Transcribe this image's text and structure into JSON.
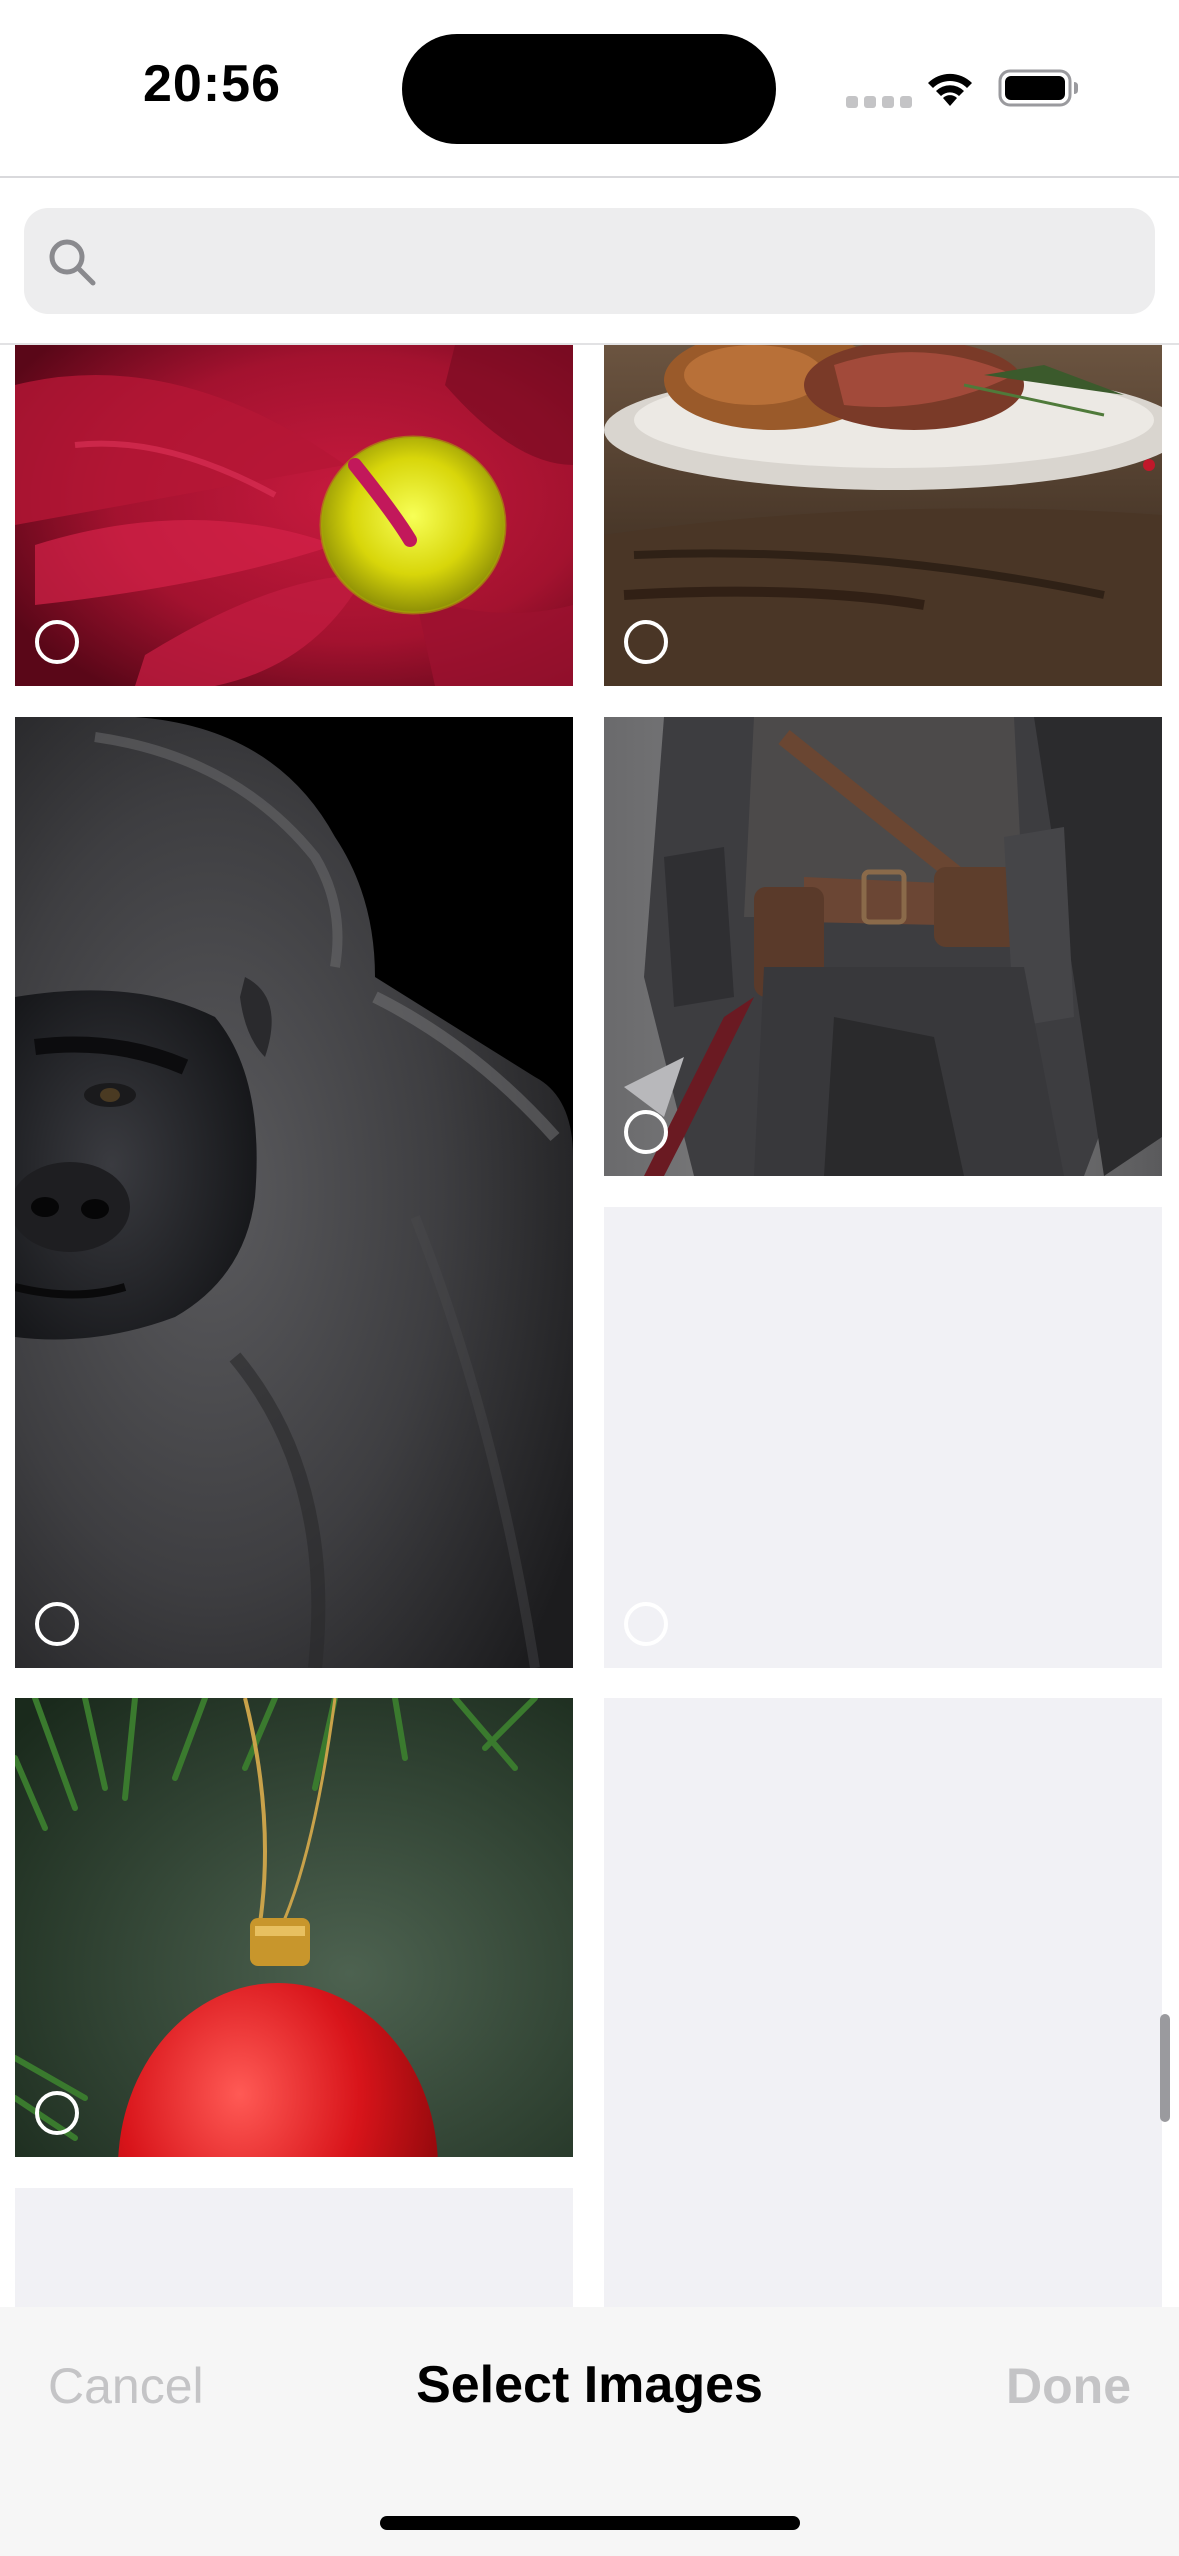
{
  "status_bar": {
    "time": "20:56"
  },
  "search": {
    "value": "",
    "placeholder": ""
  },
  "grid": {
    "tiles": [
      {
        "name": "red-flower-photo",
        "loaded": true,
        "selected": false
      },
      {
        "name": "roast-dinner-photo",
        "loaded": true,
        "selected": false
      },
      {
        "name": "gorilla-photo",
        "loaded": true,
        "selected": false
      },
      {
        "name": "armored-warrior-photo",
        "loaded": true,
        "selected": false
      },
      {
        "name": "placeholder-tile",
        "loaded": false,
        "selected": false
      },
      {
        "name": "christmas-ornament-photo",
        "loaded": true,
        "selected": false
      },
      {
        "name": "placeholder-tile",
        "loaded": false,
        "selected": false
      },
      {
        "name": "placeholder-tile",
        "loaded": false,
        "selected": false
      }
    ]
  },
  "toolbar": {
    "cancel_label": "Cancel",
    "title": "Select Images",
    "done_label": "Done"
  },
  "colors": {
    "toolbar_background": "#f6f6f6",
    "disabled_text": "#c4c4c6",
    "placeholder_tile": "#f1f1f5",
    "search_field": "#ededee"
  }
}
